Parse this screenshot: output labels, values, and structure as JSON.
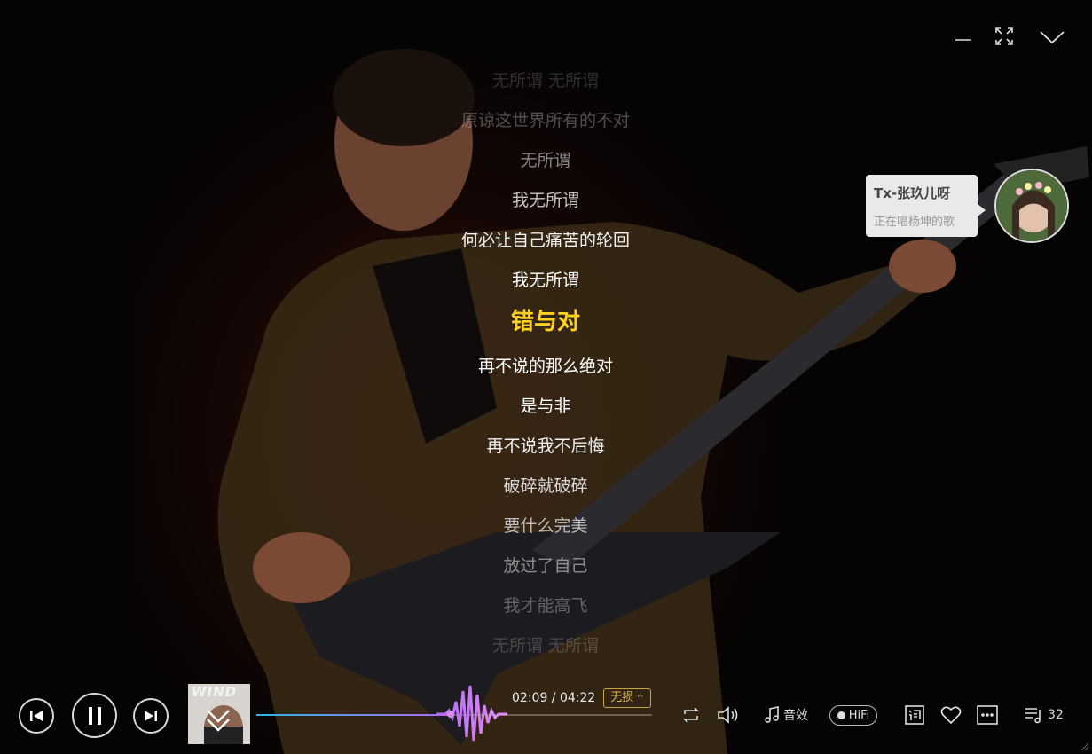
{
  "lyrics": [
    "无所谓 无所谓",
    "原谅这世界所有的不对",
    "无所谓",
    "我无所谓",
    "何必让自己痛苦的轮回",
    "我无所谓",
    "错与对",
    "再不说的那么绝对",
    "是与非",
    "再不说我不后悔",
    "破碎就破碎",
    "要什么完美",
    "放过了自己",
    "我才能高飞",
    "无所谓 无所谓"
  ],
  "current_lyric_index": 6,
  "friend": {
    "name": "Tx-张玖儿呀",
    "status": "正在唱杨坤的歌"
  },
  "player": {
    "current_time": "02:09",
    "total_time": "04:22",
    "progress": 0.49,
    "quality_label": "无损",
    "effect_label": "音效",
    "hifi_label": "HiFi",
    "playlist_count": "32",
    "cover_text": "WIND"
  },
  "colors": {
    "current_lyric": "#ffd21f",
    "quality_border": "#c9a445",
    "progress_start": "#2db7e9",
    "progress_end": "#a86cf5"
  },
  "icons": {
    "minimize": "minimize-icon",
    "fullscreen": "fullscreen-icon",
    "collapse": "chevron-down-icon",
    "prev": "previous-icon",
    "pause": "pause-icon",
    "next": "next-icon",
    "repeat": "repeat-icon",
    "volume": "volume-icon",
    "effect": "music-note-icon",
    "lyric": "lyric-icon",
    "like": "heart-icon",
    "more": "more-icon",
    "playlist": "playlist-icon"
  }
}
